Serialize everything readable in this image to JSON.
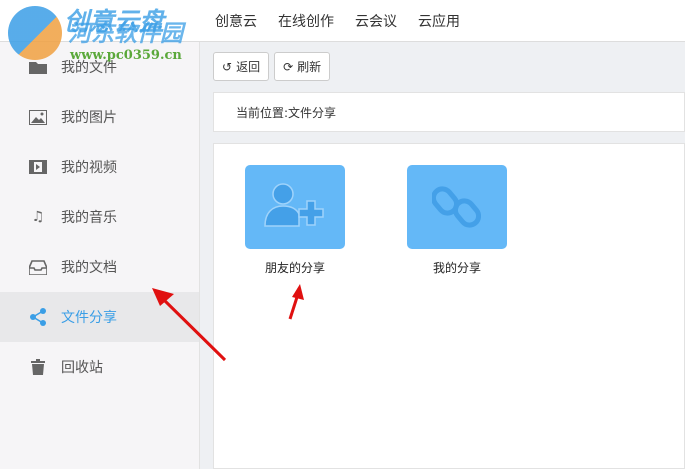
{
  "logo": {
    "title": "创意云盘",
    "watermark": "河东软件园",
    "url": "www.pc0359.cn"
  },
  "nav": [
    "创意云",
    "在线创作",
    "云会议",
    "云应用"
  ],
  "sidebar": [
    {
      "label": "我的文件",
      "icon": "folder-icon"
    },
    {
      "label": "我的图片",
      "icon": "image-icon"
    },
    {
      "label": "我的视频",
      "icon": "film-icon"
    },
    {
      "label": "我的音乐",
      "icon": "music-icon"
    },
    {
      "label": "我的文档",
      "icon": "inbox-icon"
    },
    {
      "label": "文件分享",
      "icon": "share-icon",
      "active": true
    },
    {
      "label": "回收站",
      "icon": "trash-icon"
    }
  ],
  "toolbar": {
    "back": "返回",
    "refresh": "刷新"
  },
  "breadcrumb": "当前位置:文件分享",
  "tiles": [
    {
      "label": "朋友的分享",
      "icon": "add-user-icon"
    },
    {
      "label": "我的分享",
      "icon": "link-icon"
    }
  ],
  "colors": {
    "accent": "#3a9ee6",
    "tile": "#64b8f7"
  }
}
